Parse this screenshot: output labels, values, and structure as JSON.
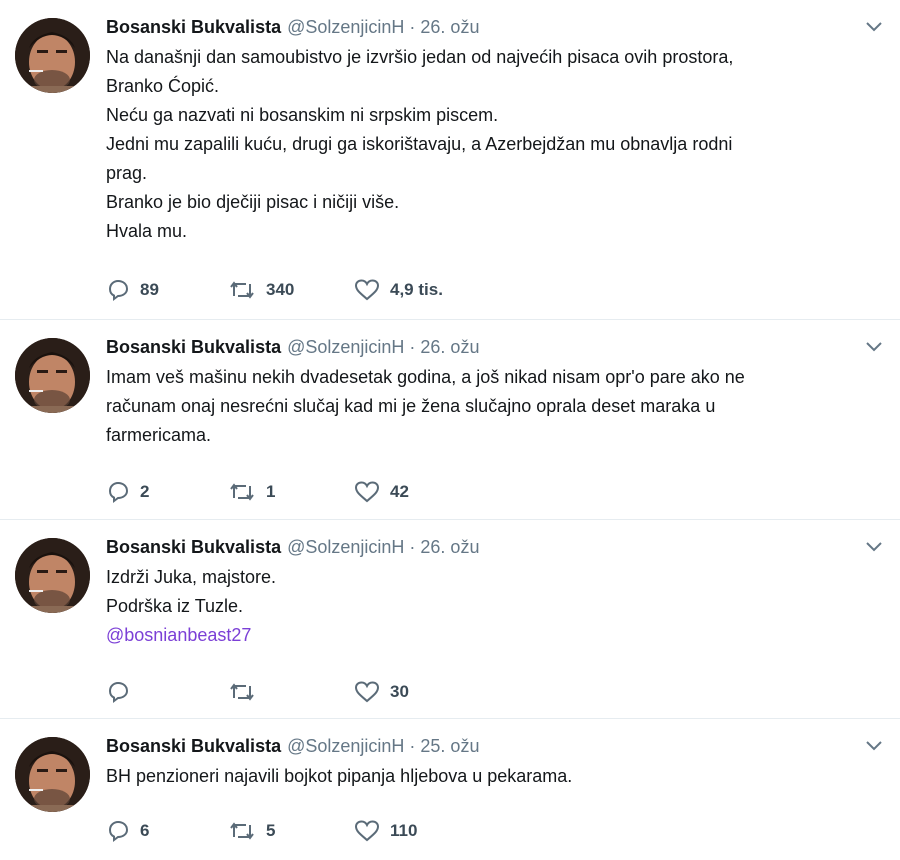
{
  "tweets": [
    {
      "name": "Bosanski Bukvalista",
      "handle": "@SolzenjicinH",
      "separator": "·",
      "date": "26. ožu",
      "lines": [
        "Na današnji dan samoubistvo je izvršio jedan od najvećih pisaca ovih prostora,",
        "Branko Ćopić.",
        "Neću ga nazvati ni bosanskim ni srpskim piscem.",
        "Jedni mu zapalili kuću, drugi ga iskorištavaju, a Azerbejdžan mu obnavlja rodni",
        "prag.",
        "Branko je bio dječiji pisac i ničiji više.",
        "Hvala mu."
      ],
      "replies": "89",
      "retweets": "340",
      "likes": "4,9 tis."
    },
    {
      "name": "Bosanski Bukvalista",
      "handle": "@SolzenjicinH",
      "separator": "·",
      "date": "26. ožu",
      "lines": [
        "Imam veš mašinu nekih dvadesetak godina, a još nikad nisam opr'o pare ako ne",
        "računam onaj nesrećni slučaj kad mi je žena slučajno oprala deset maraka u",
        "farmericama."
      ],
      "replies": "2",
      "retweets": "1",
      "likes": "42"
    },
    {
      "name": "Bosanski Bukvalista",
      "handle": "@SolzenjicinH",
      "separator": "·",
      "date": "26. ožu",
      "lines": [
        "Izdrži Juka, majstore.",
        "Podrška iz Tuzle."
      ],
      "mention": "@bosnianbeast27",
      "replies": "",
      "retweets": "",
      "likes": "30"
    },
    {
      "name": "Bosanski Bukvalista",
      "handle": "@SolzenjicinH",
      "separator": "·",
      "date": "25. ožu",
      "lines": [
        "BH penzioneri najavili bojkot pipanja hljebova u pekarama."
      ],
      "replies": "6",
      "retweets": "5",
      "likes": "110"
    }
  ],
  "icons": {
    "reply": "reply-icon",
    "retweet": "retweet-icon",
    "like": "heart-icon",
    "caret": "chevron-down-icon",
    "avatar": "avatar"
  },
  "colors": {
    "text": "#14171a",
    "secondary": "#657786",
    "mention": "#7b3fd6",
    "divider": "#e6ecf0",
    "action": "#3b4a56"
  }
}
